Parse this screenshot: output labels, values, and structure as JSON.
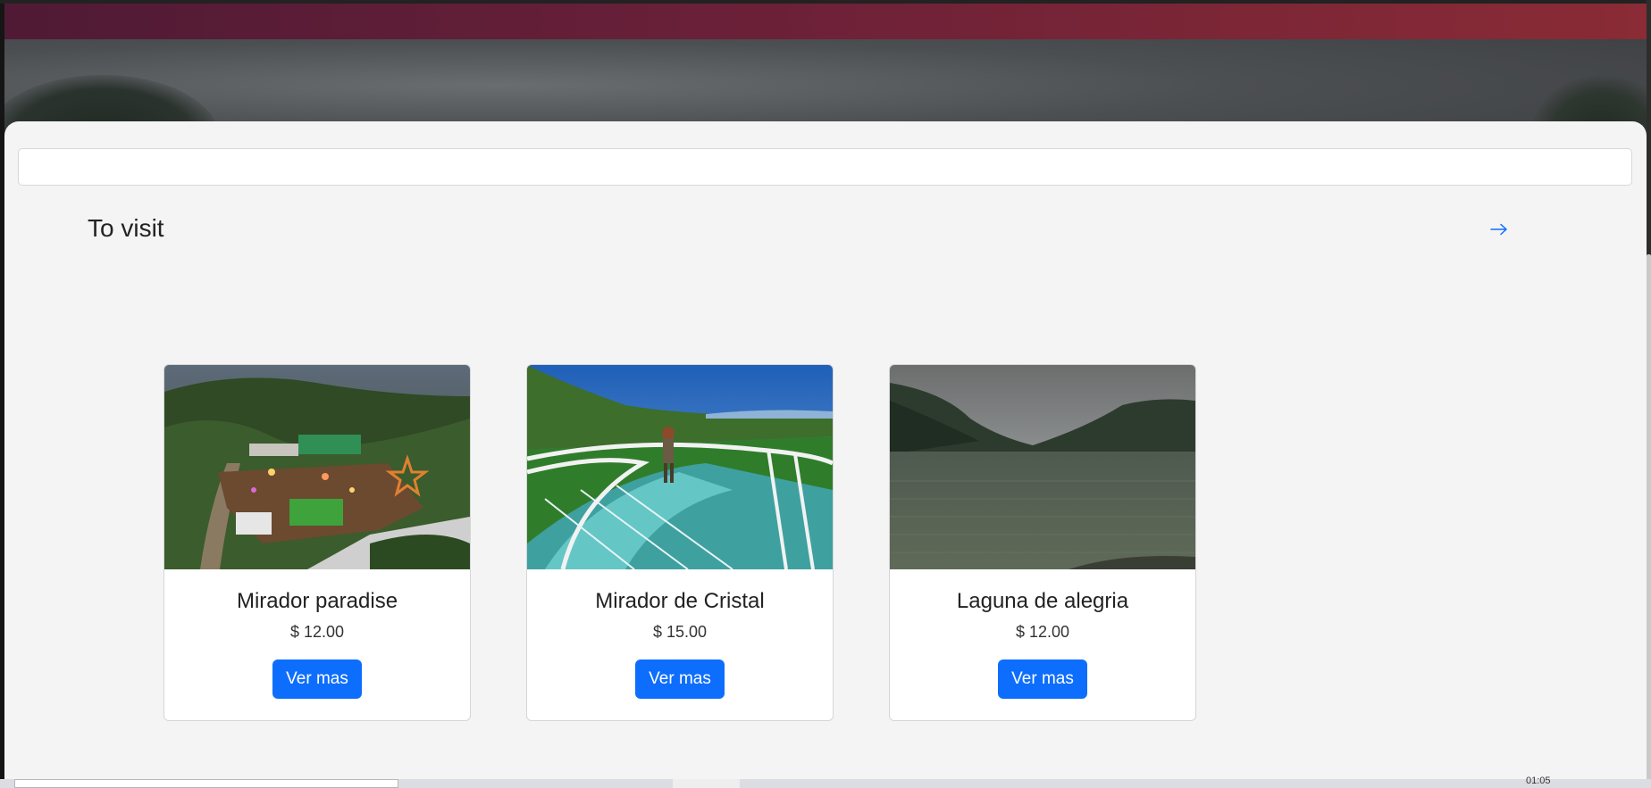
{
  "search": {
    "value": "",
    "placeholder": ""
  },
  "section": {
    "title": "To visit",
    "more_icon": "arrow-right-icon"
  },
  "cards": [
    {
      "name": "Mirador paradise",
      "price": "$ 12.00",
      "button_label": "Ver mas",
      "image": "hillside-restaurant-photo"
    },
    {
      "name": "Mirador de Cristal",
      "price": "$ 15.00",
      "button_label": "Ver mas",
      "image": "glass-viewpoint-photo"
    },
    {
      "name": "Laguna de alegria",
      "price": "$ 12.00",
      "button_label": "Ver mas",
      "image": "misty-lagoon-photo"
    }
  ],
  "colors": {
    "navbar_start": "#4f1a35",
    "navbar_end": "#8a2b35",
    "button": "#0d6efd",
    "arrow": "#0d6efd",
    "panel_bg": "#f4f4f4"
  },
  "taskbar": {
    "clock": "01:05"
  }
}
